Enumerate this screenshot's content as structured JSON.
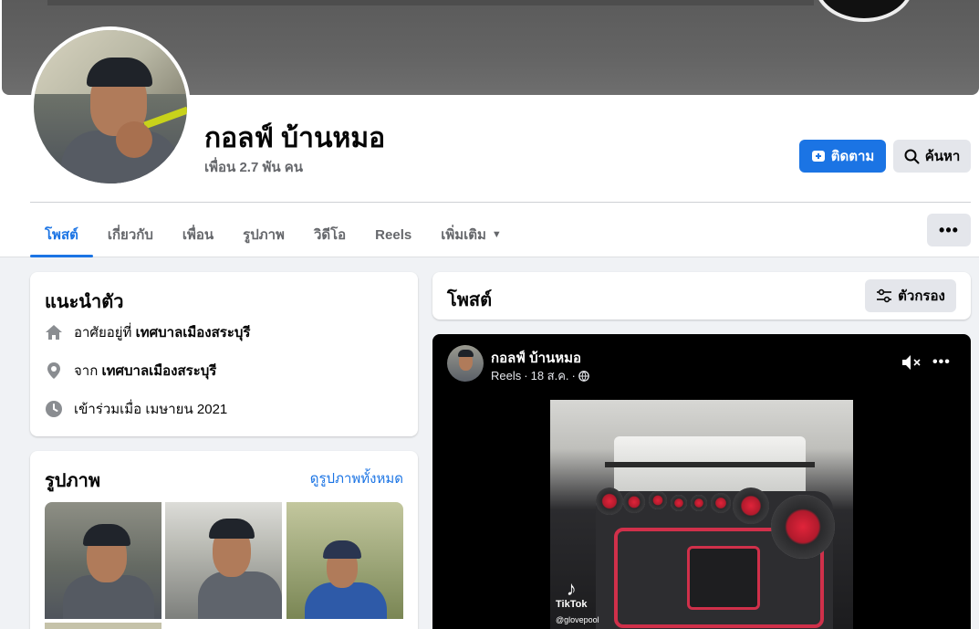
{
  "profile": {
    "name": "กอลฟ์ บ้านหมอ",
    "friends": "เพื่อน 2.7 พัน คน"
  },
  "actions": {
    "follow_label": "ติดตาม",
    "search_label": "ค้นหา",
    "more_label": "•••"
  },
  "tabs": [
    {
      "label": "โพสต์",
      "active": true
    },
    {
      "label": "เกี่ยวกับ",
      "active": false
    },
    {
      "label": "เพื่อน",
      "active": false
    },
    {
      "label": "รูปภาพ",
      "active": false
    },
    {
      "label": "วิดีโอ",
      "active": false
    },
    {
      "label": "Reels",
      "active": false
    },
    {
      "label": "เพิ่มเติม",
      "active": false
    }
  ],
  "intro": {
    "title": "แนะนำตัว",
    "rows": [
      {
        "icon": "home-icon",
        "prefix": "อาศัยอยู่ที่ ",
        "value": "เทศบาลเมืองสระบุรี"
      },
      {
        "icon": "location-pin-icon",
        "prefix": "จาก ",
        "value": "เทศบาลเมืองสระบุรี"
      },
      {
        "icon": "clock-icon",
        "prefix": "เข้าร่วมเมื่อ เมษายน 2021",
        "value": ""
      }
    ]
  },
  "photos": {
    "title": "รูปภาพ",
    "see_all": "ดูรูปภาพทั้งหมด"
  },
  "posts": {
    "title": "โพสต์",
    "filter_label": "ตัวกรอง"
  },
  "reel": {
    "author": "กอลฟ์ บ้านหมอ",
    "type": "Reels",
    "date": "18 ส.ค.",
    "more_label": "•••",
    "watermark": "TikTok",
    "watermark_user": "@glovepool"
  },
  "colors": {
    "accent": "#1b74e4",
    "background": "#f0f2f5"
  }
}
